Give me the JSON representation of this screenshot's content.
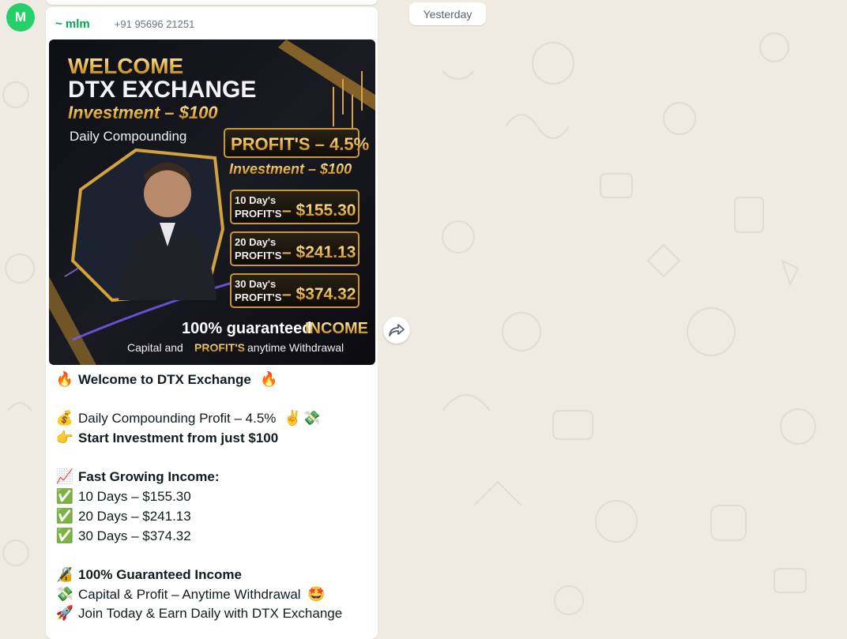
{
  "chat": {
    "date_chip": "Yesterday",
    "avatar_initial": "M"
  },
  "message": {
    "sender_name": "~ mlm",
    "sender_phone": "+91 95696 21251",
    "lines": {
      "welcome": "Welcome to DTX Exchange",
      "daily": "Daily Compounding Profit – 4.5%",
      "start": "Start Investment from just $100",
      "fast": "Fast Growing Income:",
      "d10": "10 Days – $155.30",
      "d20": "20 Days – $241.13",
      "d30": "30 Days – $374.32",
      "guaranteed": "100% Guaranteed Income",
      "withdrawal": "Capital & Profit – Anytime Withdrawal",
      "join": "Join Today & Earn Daily with DTX Exchange"
    },
    "emoji": {
      "fire": "🔥",
      "moneybag": "💰",
      "victory": "✌️",
      "flying_money": "💸",
      "point": "👉",
      "chart": "📈",
      "check": "✅",
      "lock": "🔏",
      "starstruck": "🤩",
      "rocket": "🚀"
    }
  },
  "promo": {
    "title1": "WELCOME",
    "title2": "DTX EXCHANGE",
    "investment": "Investment – $100",
    "daily": "Daily Compounding",
    "profit_rate": "PROFIT'S – 4.5%",
    "investment2": "Investment – $100",
    "rows": [
      {
        "days": "10 Day's",
        "label": "PROFIT'S",
        "amount": "– $155.30"
      },
      {
        "days": "20 Day's",
        "label": "PROFIT'S",
        "amount": "– $241.13"
      },
      {
        "days": "30 Day's",
        "label": "PROFIT'S",
        "amount": "– $374.32"
      }
    ],
    "guaranteed_a": "100% guaranteed",
    "guaranteed_b": "INCOME",
    "footer_a": "Capital and",
    "footer_b": "PROFIT'S",
    "footer_c": "anytime Withdrawal"
  },
  "icons": {
    "forward": "forward-arrow-icon"
  }
}
